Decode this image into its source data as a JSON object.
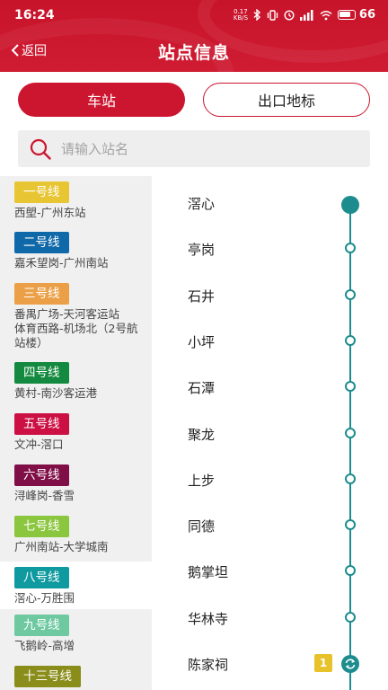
{
  "status_bar": {
    "time": "16:24",
    "net_speed_value": "0.17",
    "net_speed_unit": "KB/S",
    "battery": "66",
    "icons": [
      "bluetooth-icon",
      "vibrate-icon",
      "alarm-icon",
      "signal-icon",
      "wifi-icon",
      "battery-icon"
    ]
  },
  "header": {
    "back_label": "返回",
    "title": "站点信息",
    "color": "#c8142a"
  },
  "tabs": [
    {
      "label": "车站",
      "active": true
    },
    {
      "label": "出口地标",
      "active": false
    }
  ],
  "search": {
    "placeholder": "请输入站名",
    "value": ""
  },
  "lines": [
    {
      "name": "一号线",
      "route": "西塱-广州东站",
      "color": "#e8c533"
    },
    {
      "name": "二号线",
      "route": "嘉禾望岗-广州南站",
      "color": "#0f68a8"
    },
    {
      "name": "三号线",
      "route": "番禺广场-天河客运站\n体育西路-机场北（2号航站楼）",
      "color": "#eba047"
    },
    {
      "name": "四号线",
      "route": "黄村-南沙客运港",
      "color": "#138a3f"
    },
    {
      "name": "五号线",
      "route": "文冲-滘口",
      "color": "#cc1043"
    },
    {
      "name": "六号线",
      "route": "浔峰岗-香雪",
      "color": "#800e47"
    },
    {
      "name": "七号线",
      "route": "广州南站-大学城南",
      "color": "#8bc63f"
    },
    {
      "name": "八号线",
      "route": "滘心-万胜围",
      "color": "#0f9aa0",
      "selected": true
    },
    {
      "name": "九号线",
      "route": "飞鹅岭-高增",
      "color": "#6ec9a1"
    },
    {
      "name": "十三号线",
      "route": "",
      "color": "#8a8d1a"
    }
  ],
  "stations": [
    {
      "name": "滘心",
      "type": "current"
    },
    {
      "name": "亭岗",
      "type": "normal"
    },
    {
      "name": "石井",
      "type": "normal"
    },
    {
      "name": "小坪",
      "type": "normal"
    },
    {
      "name": "石潭",
      "type": "normal"
    },
    {
      "name": "聚龙",
      "type": "normal"
    },
    {
      "name": "上步",
      "type": "normal"
    },
    {
      "name": "同德",
      "type": "normal"
    },
    {
      "name": "鹅掌坦",
      "type": "normal"
    },
    {
      "name": "华林寺",
      "type": "normal"
    },
    {
      "name": "陈家祠",
      "type": "transfer",
      "transfer_line": "1",
      "transfer_color": "#e8c22a"
    }
  ],
  "accent_color": "#1c8c8e"
}
